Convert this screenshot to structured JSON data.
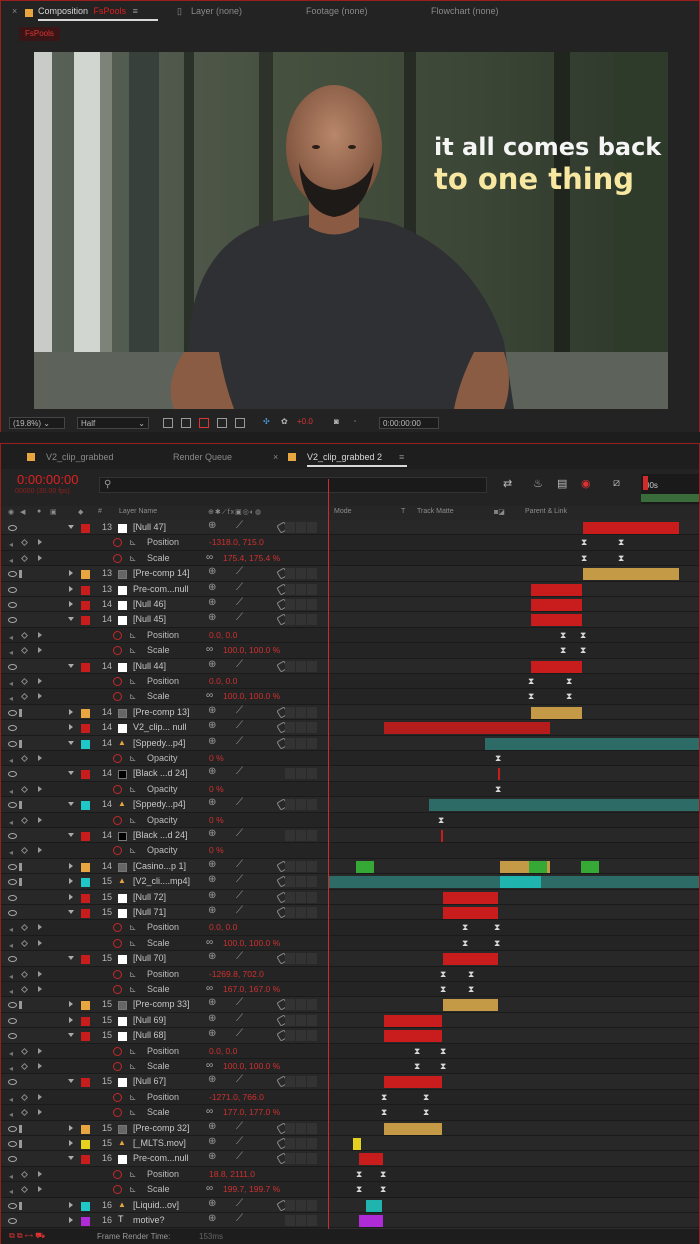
{
  "comp_panel": {
    "tab_label": "Composition",
    "comp_name": "FsPools",
    "layer_tab": "Layer (none)",
    "footage_tab": "Footage (none)",
    "flowchart_tab": "Flowchart (none)",
    "sub_tab": "FsPools",
    "overlay_line1": "it all comes back",
    "overlay_line2": "to one thing",
    "zoom": "(19.8%)",
    "resolution": "Half",
    "exposure": "+0.0",
    "timecode": "0:00:00:00"
  },
  "timeline": {
    "tabs": [
      "V2_clip_grabbed",
      "Render Queue",
      "V2_clip_grabbed 2"
    ],
    "current_time": "0:00:00:00",
    "fps_info": "00000 (30.00 fps)",
    "ruler_label": "00s",
    "columns": {
      "num": "#",
      "layer_name": "Layer Name",
      "mode": "Mode",
      "t": "T",
      "track_matte": "Track Matte",
      "parent": "Parent & Link"
    },
    "footer_label": "Frame Render Time:",
    "footer_value": "153ms"
  },
  "rows": [
    {
      "type": "layer",
      "num": "13",
      "name": "[Null 47]",
      "label": "#c91d1d",
      "icon": "null",
      "open": true
    },
    {
      "type": "prop",
      "name": "Position",
      "value": "-1318.0, 715.0"
    },
    {
      "type": "prop",
      "name": "Scale",
      "value": "175.4, 175.4 %"
    },
    {
      "type": "layer",
      "num": "13",
      "name": "[Pre-comp 14]",
      "label": "#e8a641",
      "icon": "precomp",
      "open": false
    },
    {
      "type": "layer",
      "num": "13",
      "name": "Pre-com...null",
      "label": "#c91d1d",
      "icon": "null",
      "open": false
    },
    {
      "type": "layer",
      "num": "14",
      "name": "[Null 46]",
      "label": "#c91d1d",
      "icon": "null",
      "open": false
    },
    {
      "type": "layer",
      "num": "14",
      "name": "[Null 45]",
      "label": "#c91d1d",
      "icon": "null",
      "open": true
    },
    {
      "type": "prop",
      "name": "Position",
      "value": "0.0, 0.0"
    },
    {
      "type": "prop",
      "name": "Scale",
      "value": "100.0, 100.0 %"
    },
    {
      "type": "layer",
      "num": "14",
      "name": "[Null 44]",
      "label": "#c91d1d",
      "icon": "null",
      "open": true
    },
    {
      "type": "prop",
      "name": "Position",
      "value": "0.0, 0.0"
    },
    {
      "type": "prop",
      "name": "Scale",
      "value": "100.0, 100.0 %"
    },
    {
      "type": "layer",
      "num": "14",
      "name": "[Pre-comp 13]",
      "label": "#e8a641",
      "icon": "precomp",
      "open": false
    },
    {
      "type": "layer",
      "num": "14",
      "name": "V2_clip... null",
      "label": "#c91d1d",
      "icon": "null",
      "open": false
    },
    {
      "type": "layer",
      "num": "14",
      "name": "[Sppedy...p4]",
      "label": "#1fc7c7",
      "icon": "cone",
      "open": true
    },
    {
      "type": "prop",
      "name": "Opacity",
      "value": "0 %"
    },
    {
      "type": "layer",
      "num": "14",
      "name": "[Black ...d 24]",
      "label": "#c91d1d",
      "icon": "black",
      "open": true
    },
    {
      "type": "prop",
      "name": "Opacity",
      "value": "0 %"
    },
    {
      "type": "layer",
      "num": "14",
      "name": "[Sppedy...p4]",
      "label": "#1fc7c7",
      "icon": "cone",
      "open": true
    },
    {
      "type": "prop",
      "name": "Opacity",
      "value": "0 %"
    },
    {
      "type": "layer",
      "num": "14",
      "name": "[Black ...d 24]",
      "label": "#c91d1d",
      "icon": "black",
      "open": true
    },
    {
      "type": "prop",
      "name": "Opacity",
      "value": "0 %"
    },
    {
      "type": "layer",
      "num": "14",
      "name": "[Casino...p 1]",
      "label": "#e8a641",
      "icon": "precomp",
      "open": false
    },
    {
      "type": "layer",
      "num": "15",
      "name": "[V2_cli....mp4]",
      "label": "#1fc7c7",
      "icon": "cone",
      "open": false
    },
    {
      "type": "layer",
      "num": "15",
      "name": "[Null 72]",
      "label": "#c91d1d",
      "icon": "null",
      "open": false
    },
    {
      "type": "layer",
      "num": "15",
      "name": "[Null 71]",
      "label": "#c91d1d",
      "icon": "null",
      "open": true
    },
    {
      "type": "prop",
      "name": "Position",
      "value": "0.0, 0.0"
    },
    {
      "type": "prop",
      "name": "Scale",
      "value": "100.0, 100.0 %"
    },
    {
      "type": "layer",
      "num": "15",
      "name": "[Null 70]",
      "label": "#c91d1d",
      "icon": "null",
      "open": true
    },
    {
      "type": "prop",
      "name": "Position",
      "value": "-1269.8, 702.0"
    },
    {
      "type": "prop",
      "name": "Scale",
      "value": "167.0, 167.0 %"
    },
    {
      "type": "layer",
      "num": "15",
      "name": "[Pre-comp 33]",
      "label": "#e8a641",
      "icon": "precomp",
      "open": false
    },
    {
      "type": "layer",
      "num": "15",
      "name": "[Null 69]",
      "label": "#c91d1d",
      "icon": "null",
      "open": false
    },
    {
      "type": "layer",
      "num": "15",
      "name": "[Null 68]",
      "label": "#c91d1d",
      "icon": "null",
      "open": true
    },
    {
      "type": "prop",
      "name": "Position",
      "value": "0.0, 0.0"
    },
    {
      "type": "prop",
      "name": "Scale",
      "value": "100.0, 100.0 %"
    },
    {
      "type": "layer",
      "num": "15",
      "name": "[Null 67]",
      "label": "#c91d1d",
      "icon": "null",
      "open": true
    },
    {
      "type": "prop",
      "name": "Position",
      "value": "-1271.0, 766.0"
    },
    {
      "type": "prop",
      "name": "Scale",
      "value": "177.0, 177.0 %"
    },
    {
      "type": "layer",
      "num": "15",
      "name": "[Pre-comp 32]",
      "label": "#e8a641",
      "icon": "precomp",
      "open": false
    },
    {
      "type": "layer",
      "num": "15",
      "name": "[_MLTS.mov]",
      "label": "#e6d21e",
      "icon": "cone",
      "open": false
    },
    {
      "type": "layer",
      "num": "16",
      "name": "Pre-com...null",
      "label": "#c91d1d",
      "icon": "null",
      "open": true
    },
    {
      "type": "prop",
      "name": "Position",
      "value": "18.8, 2111.0"
    },
    {
      "type": "prop",
      "name": "Scale",
      "value": "199.7, 199.7 %"
    },
    {
      "type": "layer",
      "num": "16",
      "name": "[Liquid...ov]",
      "label": "#1fc7c7",
      "icon": "cone",
      "open": false
    },
    {
      "type": "layer",
      "num": "16",
      "name": "motive?",
      "label": "#b02bd8",
      "icon": "text",
      "open": false
    }
  ],
  "colors": {
    "accent_red": "#c91d1d",
    "precomp_orange": "#e8a641",
    "teal": "#1fc7c7"
  }
}
